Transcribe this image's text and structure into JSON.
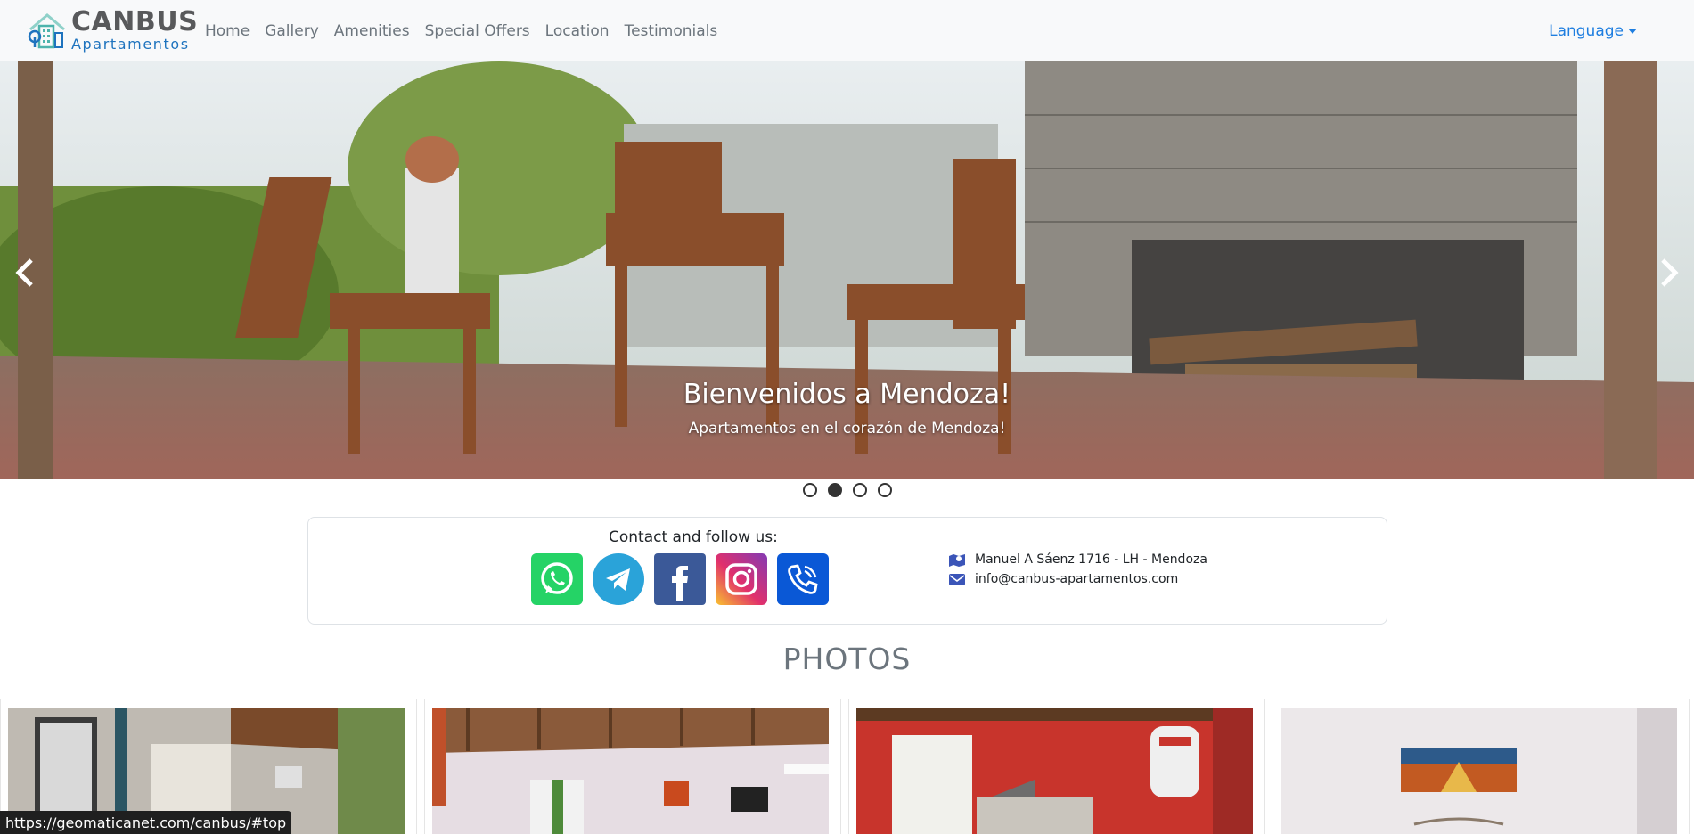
{
  "navbar": {
    "brand_title": "CANBUS",
    "brand_subtitle": "Apartamentos",
    "links": [
      "Home",
      "Gallery",
      "Amenities",
      "Special Offers",
      "Location",
      "Testimonials"
    ],
    "language_label": "Language"
  },
  "carousel": {
    "caption_title": "Bienvenidos a Mendoza!",
    "caption_subtitle": "Apartamentos en el corazón de Mendoza!",
    "slides_count": 4,
    "active_slide": 2
  },
  "contact": {
    "title": "Contact and follow us:",
    "socials": [
      "whatsapp-icon",
      "telegram-icon",
      "facebook-icon",
      "instagram-icon",
      "viber-icon"
    ],
    "address": "Manuel A Sáenz 1716 - LH - Mendoza",
    "email": "info@canbus-apartamentos.com"
  },
  "photos": {
    "title": "PHOTOS"
  },
  "status_bar": {
    "url": "https://geomaticanet.com/canbus/#top"
  },
  "colors": {
    "nav_bg": "#f8f9fa",
    "accent": "#1e7ee0",
    "whatsapp": "#25d366",
    "telegram": "#2aa3d9",
    "facebook": "#3b5998",
    "viber": "#0a58d6"
  }
}
